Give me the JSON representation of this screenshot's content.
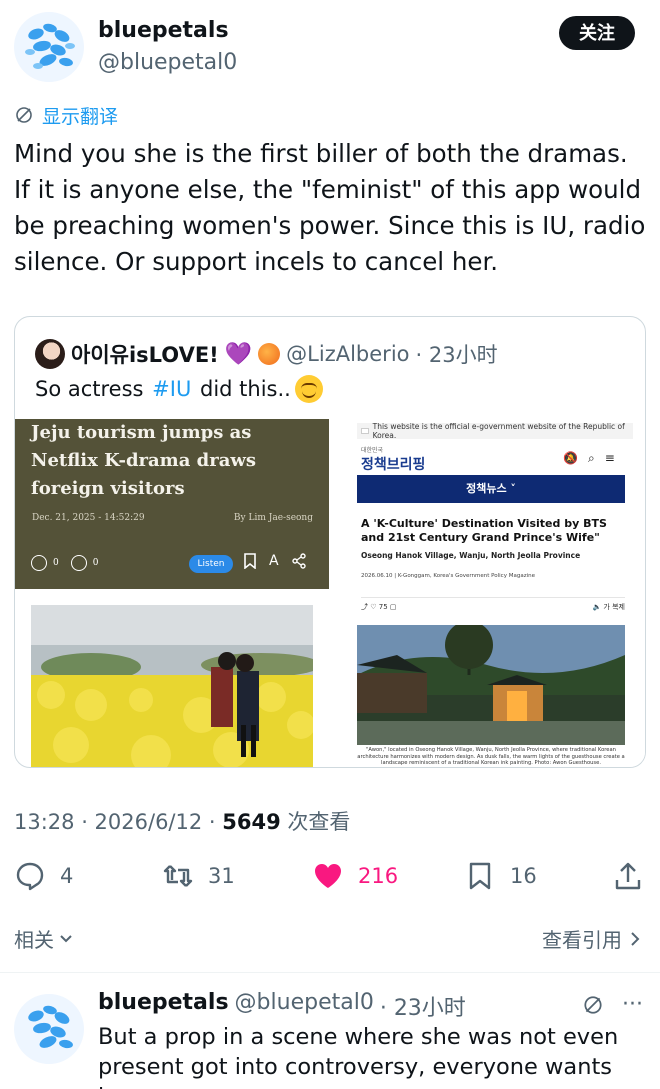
{
  "author": {
    "name": "bluepetals",
    "handle": "@bluepetal0"
  },
  "follow_label": "关注",
  "translate_label": "显示翻译",
  "tweet_text": "Mind you she is the first biller of both the dramas. If it is anyone else, the \"feminist\" of this app would be preaching women's power. Since this is IU, radio silence. Or support incels to cancel her.",
  "quote": {
    "name": "아이유isLOVE!",
    "heart": "💜",
    "handle": "@LizAlberio",
    "time": "· 23小时",
    "text_before": "So actress ",
    "hashtag": "#IU",
    "text_after": " did this.."
  },
  "left_article": {
    "headline": "Jeju tourism jumps as Netflix K-drama draws foreign visitors",
    "date": "Dec. 21, 2025 - 14:52:29",
    "byline": "By Lim Jae-seong",
    "comments": "0",
    "reactions": "0",
    "listen": "Listen",
    "font_icon": "A"
  },
  "right_article": {
    "official_notice": "This website is the official e-government website of the Republic of Korea.",
    "logo_small": "대한민국",
    "logo": "정책브리핑",
    "nav": "정책뉴스 ˅",
    "title": "A 'K-Culture' Destination Visited by BTS and 21st Century Grand Prince's Wife\"",
    "subtitle": "Oseong Hanok Village, Wanju, North Jeolla Province",
    "meta": "2026.06.10 | K-Gonggam, Korea's Government Policy Magazine",
    "share_count": "75",
    "font_label": "가",
    "print_label": "복제",
    "caption": "\"Awon,\" located in Oseong Hanok Village, Wanju, North Jeolla Province, where traditional Korean architecture harmonizes with modern design. As dusk falls, the warm lights of the guesthouse create a landscape reminiscent of a traditional Korean ink painting. Photo: Awon Guesthouse."
  },
  "meta": {
    "time": "13:28 · 2026/6/12 · ",
    "views": "5649",
    "views_label": " 次查看"
  },
  "actions": {
    "replies": "4",
    "retweets": "31",
    "likes": "216",
    "bookmarks": "16"
  },
  "related_label": "相关",
  "view_quotes_label": "查看引用",
  "reply": {
    "name": "bluepetals",
    "handle": "@bluepetal0",
    "time": "· 23小时",
    "text": "But a prop in a scene where she was not even present got into controversy, everyone wants her"
  },
  "colors": {
    "accent": "#1d9bf0",
    "like": "#f91880",
    "text": "#0f1419",
    "muted": "#536471"
  }
}
